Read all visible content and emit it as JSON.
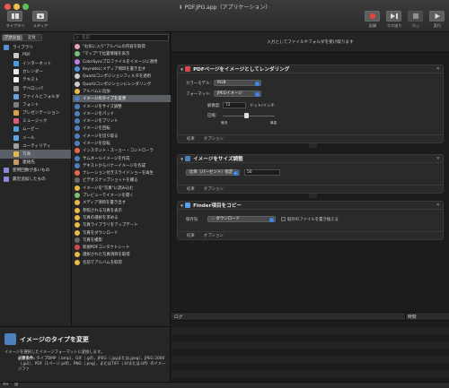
{
  "window": {
    "title": "PDF.JPG.app（アプリケーション）"
  },
  "toolbar": {
    "left": [
      {
        "label": "ライブラリ",
        "icon": "library-icon"
      },
      {
        "label": "メディア",
        "icon": "media-icon"
      }
    ],
    "right": [
      {
        "label": "記録",
        "icon": "record-icon"
      },
      {
        "label": "コマ送り",
        "icon": "step-icon"
      },
      {
        "label": "停止",
        "icon": "stop-icon"
      },
      {
        "label": "実行",
        "icon": "run-icon"
      }
    ]
  },
  "library": {
    "segments": [
      "アクション",
      "変数"
    ],
    "search_placeholder": "名前",
    "categories": [
      {
        "label": "ライブラリ",
        "color": "#5a8fd8",
        "indent": 0
      },
      {
        "label": "PDF",
        "color": "#c9c9c9",
        "indent": 1
      },
      {
        "label": "インターネット",
        "color": "#4b9be0",
        "indent": 1
      },
      {
        "label": "カレンダー",
        "color": "#e8e8e8",
        "indent": 1
      },
      {
        "label": "テキスト",
        "color": "#f0f0f0",
        "indent": 1
      },
      {
        "label": "デベロッパ",
        "color": "#9a9a9a",
        "indent": 1
      },
      {
        "label": "ファイルとフォルダ",
        "color": "#6aa0e0",
        "indent": 1
      },
      {
        "label": "フォント",
        "color": "#7d7d7d",
        "indent": 1
      },
      {
        "label": "プレゼンテーション",
        "color": "#d9a24a",
        "indent": 1
      },
      {
        "label": "ミュージック",
        "color": "#e05a7a",
        "indent": 1
      },
      {
        "label": "ムービー",
        "color": "#4ea0d8",
        "indent": 1
      },
      {
        "label": "メール",
        "color": "#5aa8e8",
        "indent": 1
      },
      {
        "label": "ユーティリティ",
        "color": "#a0a0a0",
        "indent": 1
      },
      {
        "label": "写真",
        "color": "#e8b84a",
        "indent": 1,
        "selected": true
      },
      {
        "label": "連絡先",
        "color": "#c89a6a",
        "indent": 1
      },
      {
        "label": "使用回数が多いもの",
        "color": "#8a8ad8",
        "indent": 0
      },
      {
        "label": "最近追加したもの",
        "color": "#8a8ad8",
        "indent": 0
      }
    ],
    "actions": [
      {
        "label": "\"お気に入り\"アルバムの内容を取得",
        "color": "#e8a0c0"
      },
      {
        "label": "\"マップ\"で位置情報を表示",
        "color": "#7ac07a"
      },
      {
        "label": "ColorSyncプロファイルをイメージに適用",
        "color": "#c080e0"
      },
      {
        "label": "Keynoteにメディア項目を書き出す",
        "color": "#4e8fd8"
      },
      {
        "label": "Quartzコンポジションフィルタを適用",
        "color": "#cccccc"
      },
      {
        "label": "Quartzコンポジションにレンダリング",
        "color": "#cccccc"
      },
      {
        "label": "アルバムに追加",
        "color": "#e8b84a"
      },
      {
        "label": "イメージのタイプを変更",
        "color": "#4e7fbf",
        "selected": true
      },
      {
        "label": "イメージをサイズ調整",
        "color": "#4e7fbf"
      },
      {
        "label": "イメージをパッド",
        "color": "#4e7fbf"
      },
      {
        "label": "イメージをプリント",
        "color": "#4e7fbf"
      },
      {
        "label": "イメージを回転",
        "color": "#4e7fbf"
      },
      {
        "label": "イメージを切り取る",
        "color": "#4e7fbf"
      },
      {
        "label": "イメージを反転",
        "color": "#4e7fbf"
      },
      {
        "label": "インスタント・スーョー・コントローラ",
        "color": "#e86a4a"
      },
      {
        "label": "サムネールイメージを作成",
        "color": "#4e7fbf"
      },
      {
        "label": "テキストからバナーイメージを作成",
        "color": "#4e7fbf"
      },
      {
        "label": "ナレーション付きスライドショーを再生",
        "color": "#e86a4a"
      },
      {
        "label": "ビデオスナップショットを撮る",
        "color": "#6a6a6a"
      },
      {
        "label": "イメージを\"写真\"に読み込む",
        "color": "#e8b84a"
      },
      {
        "label": "プレビューでイメージを開く",
        "color": "#7ac07a"
      },
      {
        "label": "メディア項目を書き出す",
        "color": "#e8b84a"
      },
      {
        "label": "参照される写真を表示",
        "color": "#e8b84a"
      },
      {
        "label": "写真の選択を求める",
        "color": "#e8b84a"
      },
      {
        "label": "写真ライブラリをアップデート",
        "color": "#e8b84a"
      },
      {
        "label": "写真をダウンロード",
        "color": "#e8b84a"
      },
      {
        "label": "写真を撮影",
        "color": "#6a6a6a"
      },
      {
        "label": "新規PDFコンタクトシート",
        "color": "#d84a4a"
      },
      {
        "label": "選択された写真項目を取得",
        "color": "#e8b84a"
      },
      {
        "label": "名前でアルバムを取得",
        "color": "#e8b84a"
      }
    ]
  },
  "description": {
    "title": "イメージのタイプを変更",
    "text": "イメージを選択したイメージフォーマットに変換します。",
    "req_label": "必要条件:",
    "req_text": "タイプBMP（.bmp）、GIF（.gif）、JPEG（.jpgまたは.jpeg）、JPEG 2000（.jp2）、PDF（1ページ.pdf）、PNG（.png）、またはTIFF（.tifまたは.tiff）のイメージファ"
  },
  "workflow": {
    "header_text": "入力としてファイルやフォルダを受け取ります",
    "block1": {
      "title": "PDFページをイメージとしてレンダリング",
      "color_model_label": "カラーモデル:",
      "color_model_value": "RGB",
      "format_label": "フォーマット:",
      "format_value": "JPEGイメージ",
      "resolution_label": "解像度:",
      "resolution_value": "72",
      "resolution_unit": "ドット/インチ",
      "compression_label": "圧縮:",
      "compression_min": "最低",
      "compression_max": "最高",
      "compression_level": 0.45,
      "results_label": "結果",
      "options_label": "オプション"
    },
    "block2": {
      "title": "イメージをサイズ調整",
      "mode_value": "比率（パーセント）指定",
      "percent_value": "50",
      "results_label": "結果",
      "options_label": "オプション"
    },
    "block3": {
      "title": "Finder項目をコピー",
      "dest_label": "保存先:",
      "dest_value": "ダウンロード",
      "replace_label": "既存のファイルを置き換える",
      "results_label": "結果",
      "options_label": "オプション"
    }
  },
  "log": {
    "col_log": "ログ",
    "col_time": "時間"
  }
}
